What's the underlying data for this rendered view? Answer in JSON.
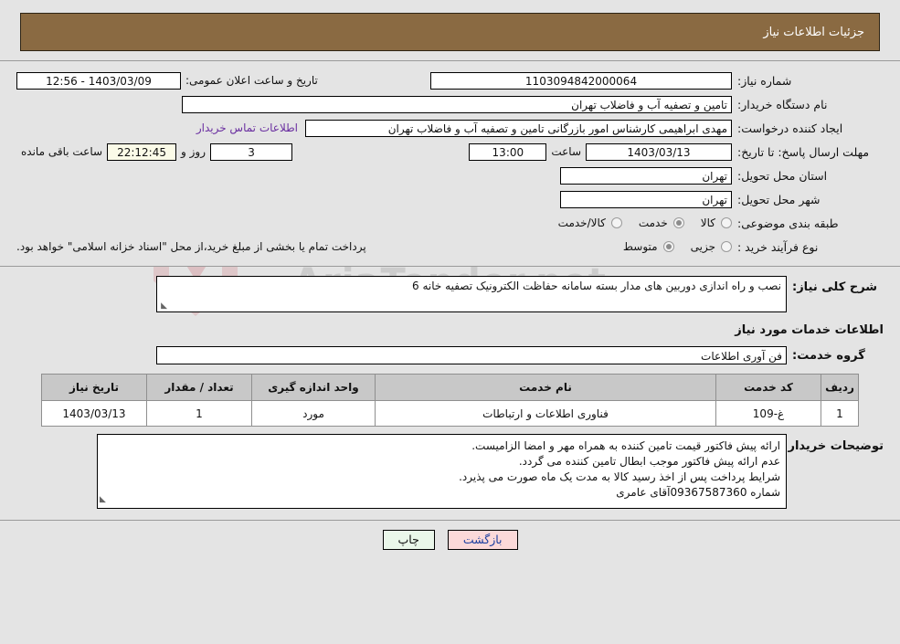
{
  "header": {
    "title": "جزئیات اطلاعات نیاز"
  },
  "form": {
    "need_number_label": "شماره نیاز:",
    "need_number_value": "1103094842000064",
    "announce_label": "تاریخ و ساعت اعلان عمومی:",
    "announce_value": "1403/03/09 - 12:56",
    "buyer_org_label": "نام دستگاه خریدار:",
    "buyer_org_value": "تامین و تصفیه آب و فاضلاب تهران",
    "creator_label": "ایجاد کننده درخواست:",
    "creator_value": "مهدی ابراهیمی کارشناس امور بازرگانی تامین و تصفیه آب و فاضلاب تهران",
    "contact_link": "اطلاعات تماس خریدار",
    "deadline_label": "مهلت ارسال پاسخ: تا تاریخ:",
    "deadline_date": "1403/03/13",
    "hour_label": "ساعت",
    "deadline_time": "13:00",
    "days_value": "3",
    "days_label": "روز و",
    "countdown_value": "22:12:45",
    "countdown_label": "ساعت باقی مانده",
    "province_label": "استان محل تحویل:",
    "province_value": "تهران",
    "city_label": "شهر محل تحویل:",
    "city_value": "تهران",
    "category_label": "طبقه بندی موضوعی:",
    "category_options": [
      {
        "label": "کالا",
        "selected": false
      },
      {
        "label": "خدمت",
        "selected": true
      },
      {
        "label": "کالا/خدمت",
        "selected": false
      }
    ],
    "process_label": "نوع فرآیند خرید :",
    "process_options": [
      {
        "label": "جزیی",
        "selected": false
      },
      {
        "label": "متوسط",
        "selected": true
      }
    ],
    "treasury_note": "پرداخت تمام یا بخشی از مبلغ خرید،از محل \"اسناد خزانه اسلامی\" خواهد بود."
  },
  "description": {
    "label": "شرح کلی نیاز:",
    "value": "نصب و راه اندازی دوربین های مدار بسته سامانه حفاظت الکترونیک تصفیه خانه 6"
  },
  "services_section": {
    "heading": "اطلاعات خدمات مورد نیاز",
    "group_label": "گروه خدمت:",
    "group_value": "فن آوری اطلاعات",
    "table": {
      "columns": [
        "ردیف",
        "کد خدمت",
        "نام خدمت",
        "واحد اندازه گیری",
        "تعداد / مقدار",
        "تاریخ نیاز"
      ],
      "rows": [
        {
          "index": "1",
          "code": "غ-109",
          "name": "فناوری اطلاعات و ارتباطات",
          "unit": "مورد",
          "quantity": "1",
          "need_date": "1403/03/13"
        }
      ]
    }
  },
  "buyer_notes": {
    "label": "توضیحات خریدار:",
    "lines": [
      "ارائه پیش فاکتور قیمت تامین کننده به همراه مهر و امضا الزامیست.",
      "عدم ارائه پیش فاکتور موجب ابطال تامین کننده می گردد.",
      "شرایط پرداخت پس از اخذ رسید کالا به مدت یک ماه صورت می پذیرد.",
      "شماره 09367587360آقای عامری"
    ]
  },
  "footer": {
    "print_label": "چاپ",
    "back_label": "بازگشت"
  },
  "watermark": {
    "text": "AriaTender.net"
  },
  "colors": {
    "header_bg": "#8a6a42",
    "page_bg": "#e4e4e4",
    "link": "#6a2fa0",
    "countdown_bg": "#fbfbe8",
    "table_header_bg": "#c8c8c8",
    "print_btn_bg": "#eaf7ea",
    "back_btn_bg": "#fbd9d9"
  }
}
